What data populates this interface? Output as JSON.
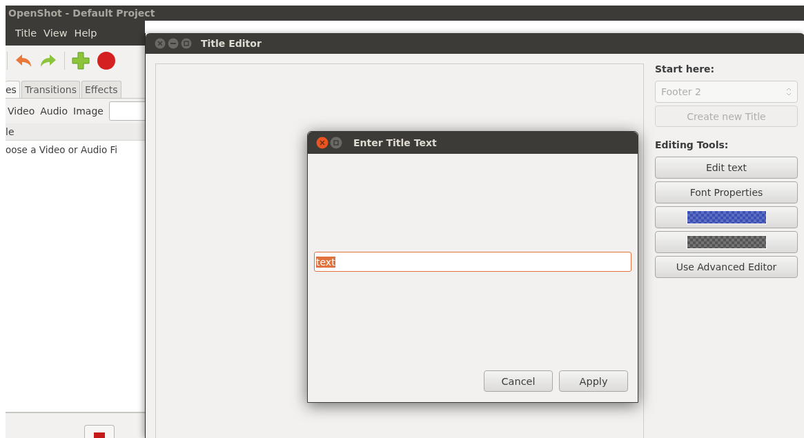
{
  "main_window": {
    "title": "OpenShot - Default Project",
    "menu": [
      "Title",
      "View",
      "Help"
    ],
    "tabs": [
      {
        "label": "es",
        "selected": true
      },
      {
        "label": "Transitions",
        "selected": false
      },
      {
        "label": "Effects",
        "selected": false
      }
    ],
    "filters": [
      "Video",
      "Audio",
      "Image"
    ],
    "column_header": "le",
    "rows": [
      "oose a Video or Audio Fi"
    ]
  },
  "title_editor": {
    "title": "Title Editor",
    "start_label": "Start here:",
    "template_select": {
      "value": "Footer 2",
      "disabled": true
    },
    "create_button": {
      "label": "Create new Title",
      "disabled": true
    },
    "tools_label": "Editing Tools:",
    "tools": [
      {
        "kind": "text",
        "label": "Edit text"
      },
      {
        "kind": "text",
        "label": "Font Properties"
      },
      {
        "kind": "swatch",
        "color": "#3a4fb4"
      },
      {
        "kind": "swatch",
        "color": "#555555"
      },
      {
        "kind": "text",
        "label": "Use Advanced Editor"
      }
    ]
  },
  "dialog": {
    "title": "Enter Title Text",
    "input": {
      "value": "text",
      "selected": true
    },
    "buttons": [
      "Cancel",
      "Apply"
    ]
  }
}
